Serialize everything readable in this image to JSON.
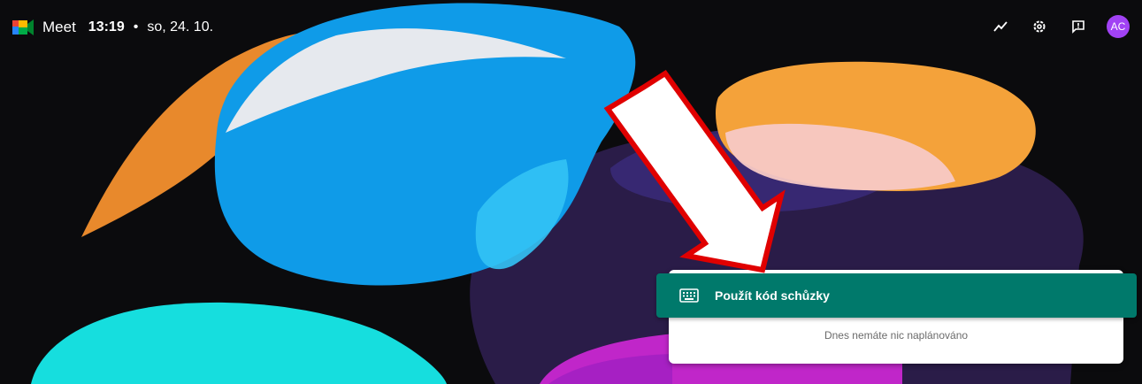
{
  "header": {
    "app_name": "Meet",
    "time": "13:19",
    "separator": "•",
    "date": "so, 24. 10."
  },
  "top_actions": {
    "icons": [
      "trending-icon",
      "settings-icon",
      "feedback-icon"
    ],
    "avatar_initials": "AC",
    "avatar_color": "#a142f4"
  },
  "meeting_panel": {
    "join_label": "Použít kód schůzky",
    "join_color": "#00796b",
    "empty_message": "Dnes nemáte nic naplánováno"
  },
  "annotation": {
    "arrow_color": "#e00000"
  }
}
